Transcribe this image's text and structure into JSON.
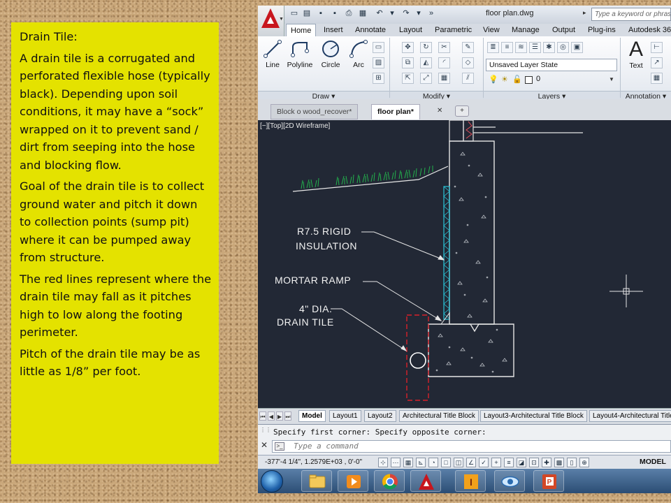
{
  "note": {
    "paragraphs": [
      "Drain Tile:",
      "A drain tile is a corrugated and perforated flexible hose (typically black).  Depending upon soil conditions, it may have a “sock” wrapped on it to prevent sand / dirt from seeping into the hose and blocking flow.",
      "Goal of the drain tile is to collect ground water and pitch it down to collection points (sump pit) where it can be pumped away from structure.",
      "The red lines represent where the drain tile may fall as it pitches high to low along the footing perimeter.",
      "Pitch of the drain tile may be as little as 1/8” per foot."
    ]
  },
  "acad": {
    "title": "floor plan.dwg",
    "search_placeholder": "Type a keyword or phrase",
    "ribbon_tabs": [
      "Home",
      "Insert",
      "Annotate",
      "Layout",
      "Parametric",
      "View",
      "Manage",
      "Output",
      "Plug-ins",
      "Autodesk 36"
    ],
    "draw_tools": [
      "Line",
      "Polyline",
      "Circle",
      "Arc"
    ],
    "panels": {
      "draw": "Draw",
      "modify": "Modify",
      "layers": "Layers",
      "annotation": "Annotation"
    },
    "layer_state": "Unsaved Layer State",
    "layer_current": "0",
    "text_tool": "Text",
    "file_tabs": [
      "Block o wood_recover*",
      "floor plan*"
    ],
    "viewport_label": "[−][Top][2D Wireframe]",
    "drawing_labels": {
      "insulation_1": "R7.5 RIGID",
      "insulation_2": "INSULATION",
      "mortar": "MORTAR RAMP",
      "drain_1": "4\" DIA.",
      "drain_2": "DRAIN TILE"
    },
    "layout_tabs": [
      "Model",
      "Layout1",
      "Layout2",
      "Architectural Title Block",
      "Layout3-Architectural Title Block",
      "Layout4-Architectural Title"
    ],
    "command_history": "Specify first corner: Specify opposite corner:",
    "command_placeholder": "Type a command",
    "coordinates": "-377'-4 1/4\", 1.2579E+03 , 0'-0\"",
    "mode": "MODEL"
  },
  "colors": {
    "note_bg": "#e4e200",
    "canvas_bg": "#222835",
    "drain_path": "#d8212a",
    "insulation": "#29c4d8",
    "grass": "#22b14c"
  }
}
